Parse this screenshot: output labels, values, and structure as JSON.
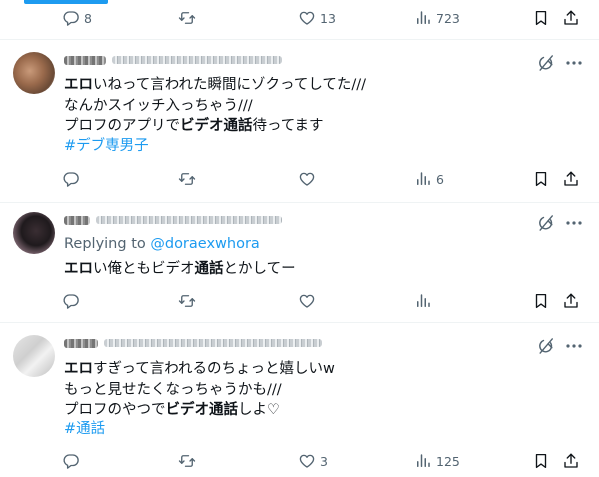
{
  "top_bar": {
    "reply_count": "8",
    "like_count": "13",
    "views_count": "723"
  },
  "tweets": [
    {
      "lines": [
        [
          {
            "t": "エロ",
            "b": true
          },
          {
            "t": "いねって言われた瞬間にゾクってしてた///"
          }
        ],
        [
          {
            "t": "なんかスイッチ入っちゃう///"
          }
        ],
        [
          {
            "t": "プロフのアプリで"
          },
          {
            "t": "ビデオ通話",
            "b": true
          },
          {
            "t": "待ってます"
          }
        ]
      ],
      "hashtag": "#デブ専男子",
      "reply_count": "",
      "like_count": "",
      "views_count": "6"
    },
    {
      "replying_label": "Replying to",
      "replying_handle": "@doraexwhora",
      "lines": [
        [
          {
            "t": "エロ",
            "b": true
          },
          {
            "t": "い俺ともビデオ"
          },
          {
            "t": "通話",
            "b": true
          },
          {
            "t": "とかしてー"
          }
        ]
      ],
      "reply_count": "",
      "like_count": "",
      "views_count": ""
    },
    {
      "lines": [
        [
          {
            "t": "エロ",
            "b": true
          },
          {
            "t": "すぎって言われるのちょっと嬉しいw"
          }
        ],
        [
          {
            "t": "もっと見せたくなっちゃうかも///"
          }
        ],
        [
          {
            "t": "プロフのやつで"
          },
          {
            "t": "ビデオ通話",
            "b": true
          },
          {
            "t": "しよ♡"
          }
        ]
      ],
      "hashtag": "#通話",
      "reply_count": "",
      "like_count": "3",
      "views_count": "125"
    }
  ],
  "colors": {
    "accent": "#1d9bf0",
    "muted": "#536471",
    "divider": "#eff3f4",
    "text": "#0f1419"
  },
  "icons": [
    "reply-icon",
    "retweet-icon",
    "like-icon",
    "views-icon",
    "bookmark-icon",
    "share-icon",
    "grok-icon",
    "more-icon"
  ]
}
